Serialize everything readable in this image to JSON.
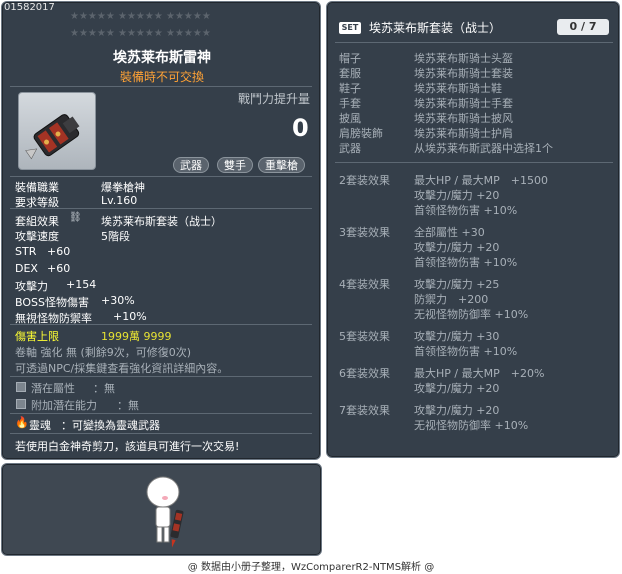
{
  "item": {
    "id": "01582017",
    "name": "埃苏莱布斯雷神",
    "trade_note": "裝備時不可交換",
    "combat_label": "戰鬥力提升量",
    "combat_value": "0",
    "tags": [
      "武器",
      "雙手",
      "重擊槍"
    ],
    "job_label": "裝備職業",
    "job_value": "爆拳槍神",
    "level_label": "要求等級",
    "level_value": "Lv.160",
    "set_effect_label": "套組效果",
    "set_effect_value": "埃苏莱布斯套装（战士）",
    "attack_speed_label": "攻擊速度",
    "attack_speed_value": "5階段",
    "stats": [
      {
        "name": "STR",
        "value": "+60"
      },
      {
        "name": "DEX",
        "value": "+60"
      },
      {
        "name": "攻擊力",
        "value": "+154"
      },
      {
        "name": "BOSS怪物傷害",
        "value": "+30%"
      },
      {
        "name": "無視怪物防禦率",
        "value": "+10%"
      }
    ],
    "damage_cap_label": "傷害上限",
    "damage_cap_value": "1999萬 9999",
    "scroll_line": "卷軸 強化 無 (剩餘9次，可修復0次)",
    "npc_line": "可透過NPC/採集鍵查看強化資訊詳細內容。",
    "potential_label": "潛在屬性",
    "potential_value": "：無",
    "bonus_potential_label": "附加潛在能力",
    "bonus_potential_value": "：無",
    "soul_label": "靈魂",
    "soul_value": "：可變換為靈魂武器",
    "scissors_note": "若使用白金神奇剪刀，該道具可進行一次交易!"
  },
  "set": {
    "badge": "SET",
    "name": "埃苏莱布斯套装（战士）",
    "count": "0 / 7",
    "parts": [
      {
        "slot": "帽子",
        "item": "埃苏莱布斯骑士头盔"
      },
      {
        "slot": "套服",
        "item": "埃苏莱布斯骑士套装"
      },
      {
        "slot": "鞋子",
        "item": "埃苏莱布斯骑士鞋"
      },
      {
        "slot": "手套",
        "item": "埃苏莱布斯骑士手套"
      },
      {
        "slot": "披風",
        "item": "埃苏莱布斯骑士披风"
      },
      {
        "slot": "肩膀裝飾",
        "item": "埃苏莱布斯骑士护肩"
      },
      {
        "slot": "武器",
        "item": "从埃苏莱布斯武器中选择1个"
      }
    ],
    "bonuses": [
      {
        "label": "2套装效果",
        "lines": [
          "最大HP / 最大MP　+1500",
          "攻擊力/魔力 +20",
          "首领怪物伤害 +10%"
        ]
      },
      {
        "label": "3套装效果",
        "lines": [
          "全部屬性 +30",
          "攻擊力/魔力 +20",
          "首领怪物伤害 +10%"
        ]
      },
      {
        "label": "4套装效果",
        "lines": [
          "攻擊力/魔力 +25",
          "防禦力　+200",
          "无视怪物防御率 +10%"
        ]
      },
      {
        "label": "5套装效果",
        "lines": [
          "攻擊力/魔力 +30",
          "首领怪物伤害 +10%"
        ]
      },
      {
        "label": "6套装效果",
        "lines": [
          "最大HP / 最大MP　+20%",
          "攻擊力/魔力 +20"
        ]
      },
      {
        "label": "7套装效果",
        "lines": [
          "攻擊力/魔力 +20",
          "无视怪物防御率 +10%"
        ]
      }
    ]
  },
  "footer": "@ 数据由小册子整理，WzComparerR2-NTMS解析 @",
  "colors": {
    "panel_bg": "#353f4a",
    "trade_note": "#ffa235",
    "damage_cap_label": "#ffff33",
    "damage_cap_value": "#e6e233",
    "muted": "#a8b0b8"
  }
}
